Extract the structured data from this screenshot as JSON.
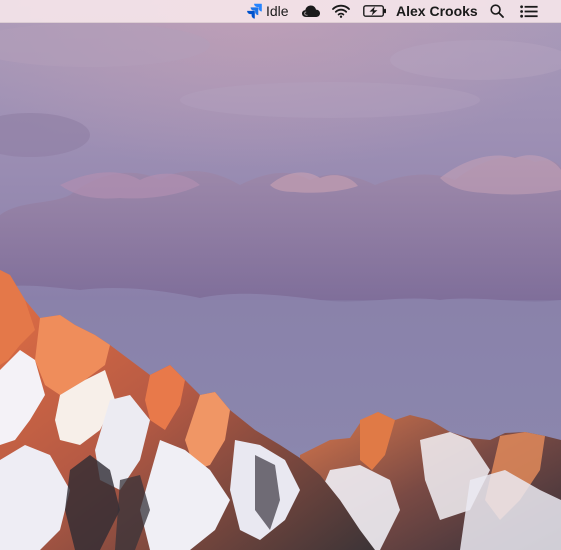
{
  "menubar": {
    "status_icon": "jira-icon",
    "status_label": "Idle",
    "cloud_icon": "cloud-icon",
    "wifi_icon": "wifi-icon",
    "battery_icon": "battery-charging-icon",
    "user_name": "Alex Crooks",
    "search_icon": "spotlight-search-icon",
    "notification_icon": "notification-center-icon"
  },
  "desktop": {
    "wallpaper": "sierra-mountain-wallpaper"
  },
  "colors": {
    "menubar_bg": "#f8e8ec",
    "status_icon_blue": "#2684ff",
    "sky_top": "#a79ab7",
    "mountain_glow": "#e2764a"
  }
}
